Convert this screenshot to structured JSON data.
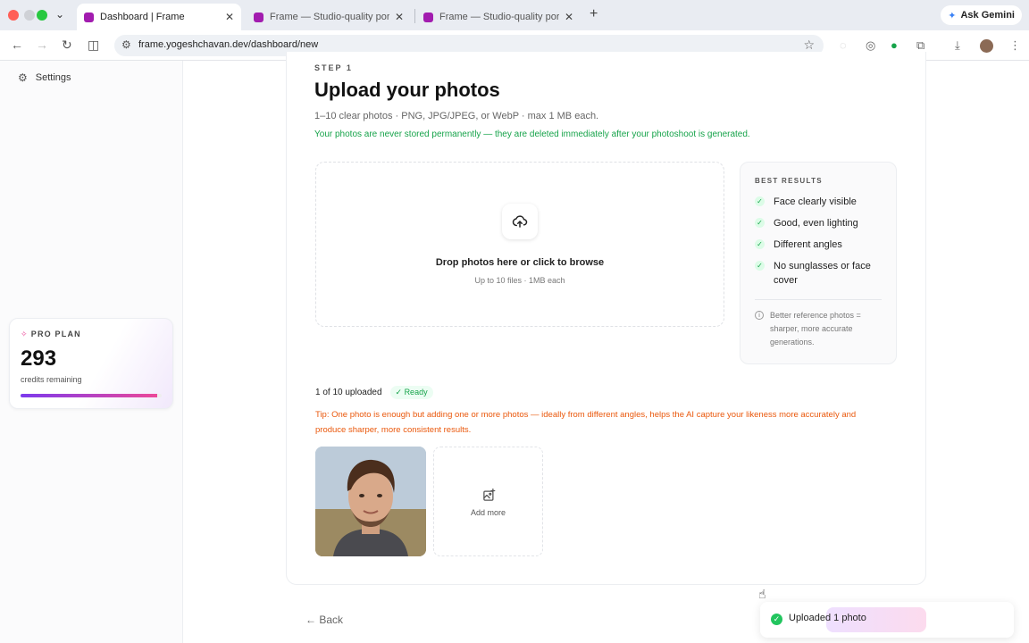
{
  "browser": {
    "tabs": [
      {
        "title": "Dashboard | Frame",
        "active": true
      },
      {
        "title": "Frame — Studio-quality portraits",
        "active": false
      },
      {
        "title": "Frame — Studio-quality portraits",
        "active": false
      }
    ],
    "url": "frame.yogeshchavan.dev/dashboard/new",
    "gemini_label": "Ask Gemini"
  },
  "sidebar": {
    "settings_label": "Settings",
    "plan": {
      "label": "PRO PLAN",
      "credits": "293",
      "credits_label": "credits remaining",
      "credits_fraction": 0.97
    }
  },
  "main": {
    "step": "STEP 1",
    "title": "Upload your photos",
    "description": "1–10 clear photos · PNG, JPG/JPEG, or WebP · max 1 MB each.",
    "privacy": "Your photos are never stored permanently — they are deleted immediately after your photoshoot is generated.",
    "dropzone": {
      "title": "Drop photos here or click to browse",
      "subtitle": "Up to 10 files · 1MB each"
    },
    "tips": {
      "heading": "BEST RESULTS",
      "items": [
        "Face clearly visible",
        "Good, even lighting",
        "Different angles",
        "No sunglasses or face cover"
      ],
      "note": "Better reference photos = sharper, more accurate generations."
    },
    "upload_count": "1 of 10 uploaded",
    "status": "Ready",
    "tip_prefix": "Tip:",
    "tip_text": "One photo is enough but adding one or more photos — ideally from different angles, helps the AI capture your likeness more accurately and produce sharper, more consistent results.",
    "add_more": "Add more",
    "back": "Back"
  },
  "toast": {
    "message": "Uploaded 1 photo"
  },
  "colors": {
    "accent_purple": "#7c3aed",
    "accent_pink": "#ec4899",
    "success": "#16a34a",
    "tip_orange": "#ea580c"
  }
}
